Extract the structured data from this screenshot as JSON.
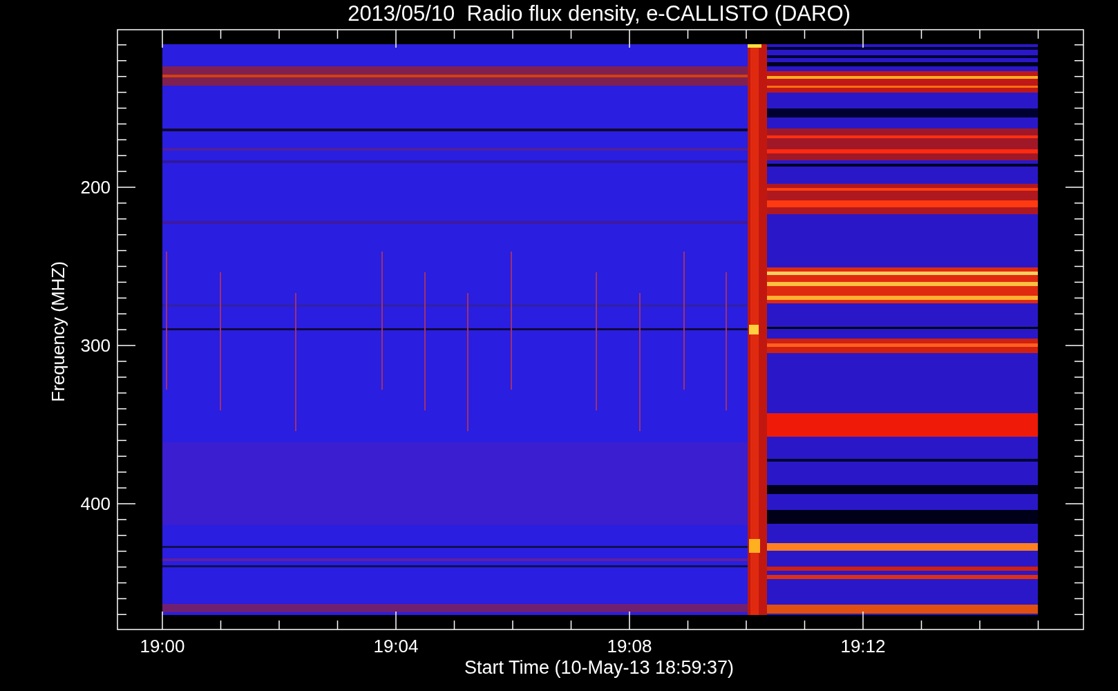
{
  "title": "2013/05/10  Radio flux density, e-CALLISTO (DARO)",
  "plot": {
    "ylabel": "Frequency (MHZ)",
    "xlabel": "Start Time (10-May-13 18:59:37)",
    "yticks": [
      "200",
      "300",
      "400"
    ],
    "xticks": [
      "19:00",
      "19:04",
      "19:08",
      "19:12"
    ]
  }
}
